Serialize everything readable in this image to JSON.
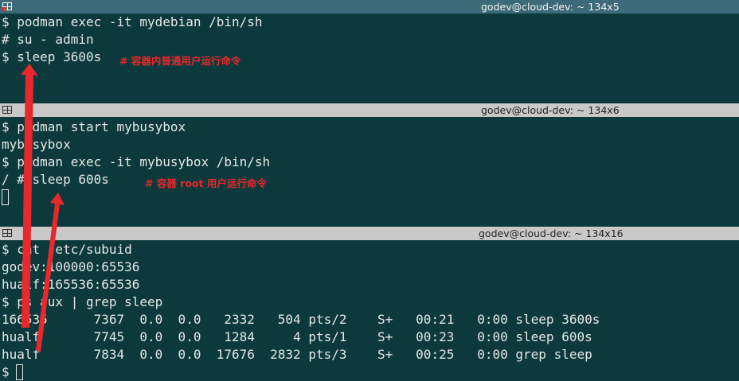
{
  "panes": [
    {
      "title": "godev@cloud-dev: ~ 134x5",
      "lines": [
        "$ podman exec -it mydebian /bin/sh",
        "# su - admin",
        "$ sleep 3600s"
      ],
      "annotation": "# 容器内普通用户运行命令"
    },
    {
      "title": "godev@cloud-dev: ~ 134x6",
      "lines": [
        "$ podman start mybusybox",
        "mybusybox",
        "$ podman exec -it mybusybox /bin/sh",
        "/ # sleep 600s"
      ],
      "annotation": "# 容器 root 用户运行命令"
    },
    {
      "title": "godev@cloud-dev: ~ 134x16",
      "lines": [
        "$ cat /etc/subuid",
        "godev:100000:65536",
        "hualf:165536:65536",
        "$ ps aux | grep sleep",
        "166535      7367  0.0  0.0   2332   504 pts/2    S+   00:21   0:00 sleep 3600s",
        "hualf       7745  0.0  0.0   1284     4 pts/1    S+   00:23   0:00 sleep 600s",
        "hualf       7834  0.0  0.0  17676  2832 pts/3    S+   00:25   0:00 grep sleep",
        "$ "
      ]
    }
  ],
  "colors": {
    "terminal_bg": "#0c3a3c",
    "active_title": "#3c6a78",
    "inactive_title": "#c9c9c9",
    "annotation": "#e8282a"
  }
}
